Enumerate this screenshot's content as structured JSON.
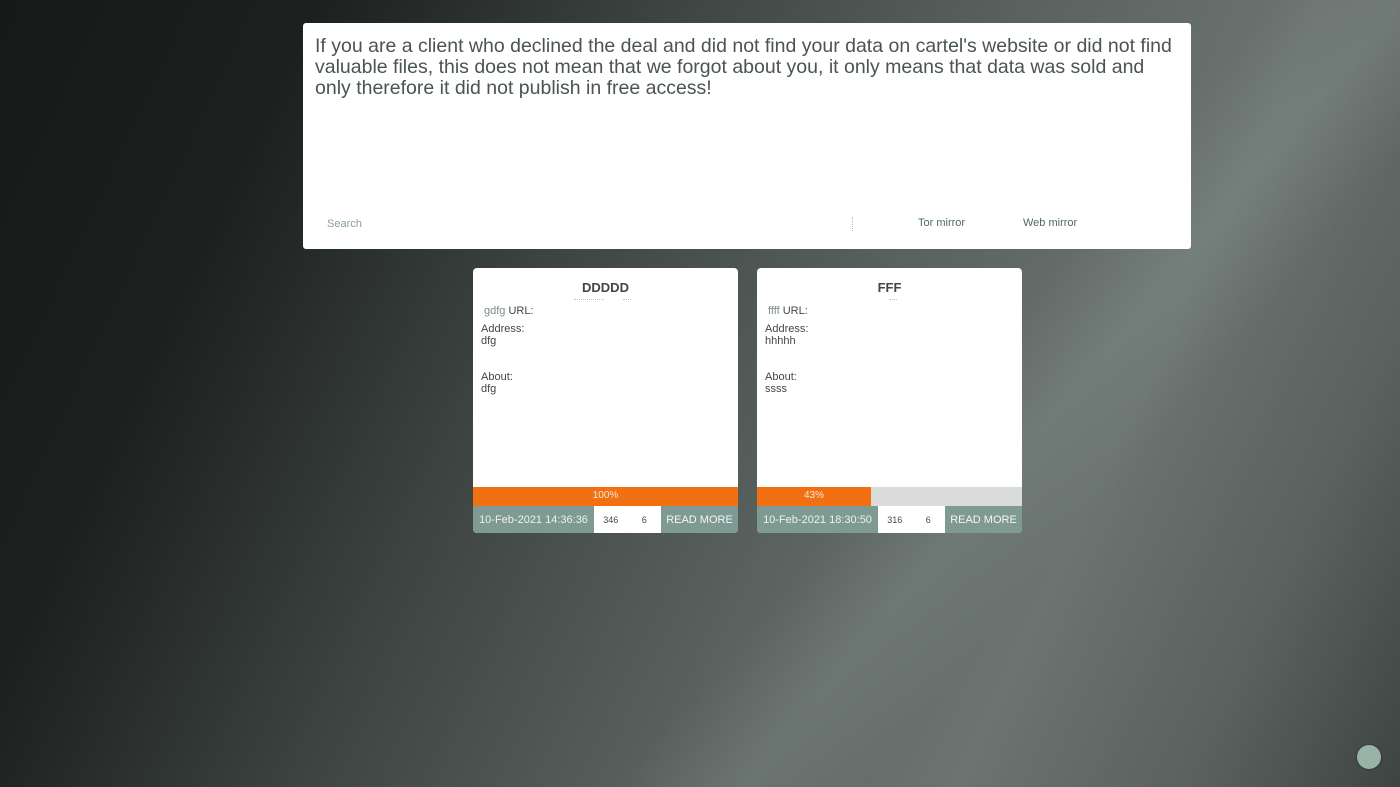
{
  "notice": "If you are a client who declined the deal and did not find your data on cartel's website or did not find valuable files, this does not mean that we forgot about you, it only means that data was sold and only therefore it did not publish in free access!",
  "search": {
    "placeholder": "Search"
  },
  "nav": {
    "tor_mirror": "Tor mirror",
    "web_mirror": "Web mirror"
  },
  "cards": [
    {
      "title": "DDDDD",
      "url_name": "gdfg",
      "url_label": "URL:",
      "address_label": "Address:",
      "address": "dfg",
      "about_label": "About:",
      "about": "dfg",
      "progress": 100,
      "progress_label": "100%",
      "date": "10-Feb-2021 14:36:36",
      "views": "346",
      "count": "6",
      "read_more": "READ MORE"
    },
    {
      "title": "FFF",
      "url_name": "ffff",
      "url_label": "URL:",
      "address_label": "Address:",
      "address": "hhhhh",
      "about_label": "About:",
      "about": "ssss",
      "progress": 43,
      "progress_label": "43%",
      "date": "10-Feb-2021 18:30:50",
      "views": "316",
      "count": "6",
      "read_more": "READ MORE"
    }
  ],
  "colors": {
    "accent": "#f27012",
    "footer": "#7e9a92"
  }
}
